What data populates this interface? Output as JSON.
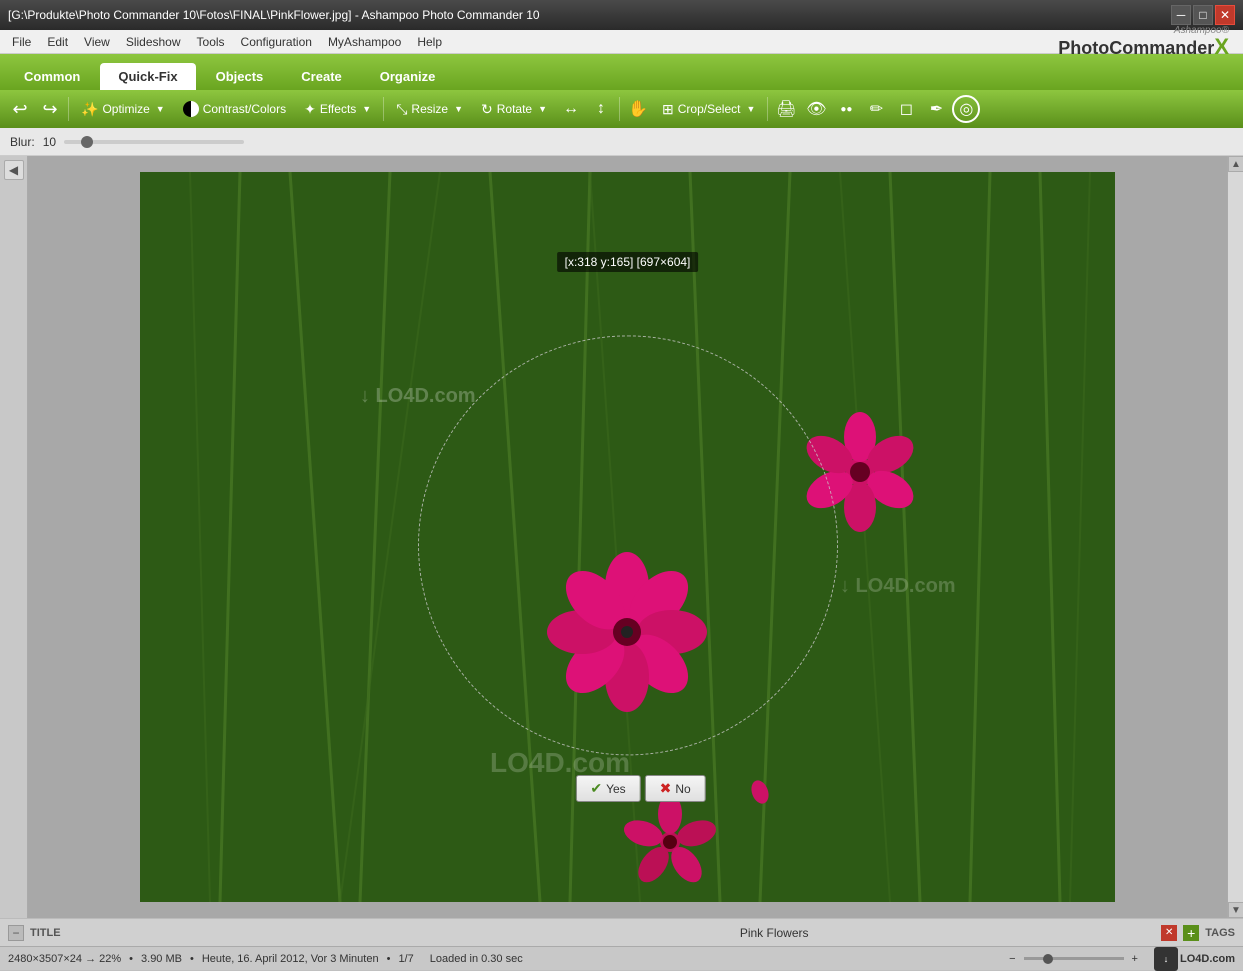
{
  "window": {
    "title": "[G:\\Produkte\\Photo Commander 10\\Fotos\\FINAL\\PinkFlower.jpg] - Ashampoo Photo Commander 10"
  },
  "titlebar": {
    "title": "[G:\\Produkte\\Photo Commander 10\\Fotos\\FINAL\\PinkFlower.jpg] - Ashampoo Photo Commander 10",
    "minimize": "─",
    "maximize": "□",
    "close": "✕"
  },
  "menubar": {
    "items": [
      "File",
      "Edit",
      "View",
      "Slideshow",
      "Tools",
      "Configuration",
      "MyAshampoo",
      "Help"
    ]
  },
  "tabs": {
    "items": [
      "Common",
      "Quick-Fix",
      "Objects",
      "Create",
      "Organize"
    ],
    "active": "Quick-Fix"
  },
  "toolbar": {
    "undo_label": "◄",
    "redo_label": "►",
    "optimize_label": "Optimize",
    "contrast_label": "Contrast/Colors",
    "effects_label": "Effects",
    "resize_label": "Resize",
    "rotate_label": "Rotate",
    "flip_h_label": "↔",
    "flip_v_label": "↕",
    "hand_label": "✋",
    "crop_label": "Crop/Select",
    "print_label": "🖨",
    "redeye_label": "👁",
    "skin_label": "●●",
    "brush_label": "✏",
    "erase_label": "◻",
    "pen_label": "✒",
    "target_label": "◎"
  },
  "blurbar": {
    "label": "Blur:",
    "value": "10"
  },
  "image": {
    "coordinates": "[x:318 y:165] [697×604]",
    "name": "Pink Flowers",
    "watermark1": "↓ LO4D.com",
    "watermark2": "↓ LO4D.com"
  },
  "confirm": {
    "yes_label": "Yes",
    "no_label": "No"
  },
  "titletagbar": {
    "minus": "−",
    "title_label": "TITLE",
    "close_icon": "✕",
    "plus_icon": "+",
    "tags_label": "TAGS",
    "center_text": "Pink Flowers"
  },
  "statusbar": {
    "dimensions": "2480×3507×24 → 22%",
    "filesize": "3.90 MB",
    "datetime": "Heute, 16. April 2012, Vor 3 Minuten",
    "position": "1/7",
    "loadtime": "Loaded in 0.30 sec"
  },
  "logo": {
    "ashampoo": "Ashampoo®",
    "photo": "Photo",
    "commander": "Commander",
    "x": "X"
  },
  "colors": {
    "green_dark": "#5a8f1a",
    "green_light": "#8dc63f",
    "tab_active_bg": "#ffffff",
    "toolbar_bg": "#6aa520"
  }
}
